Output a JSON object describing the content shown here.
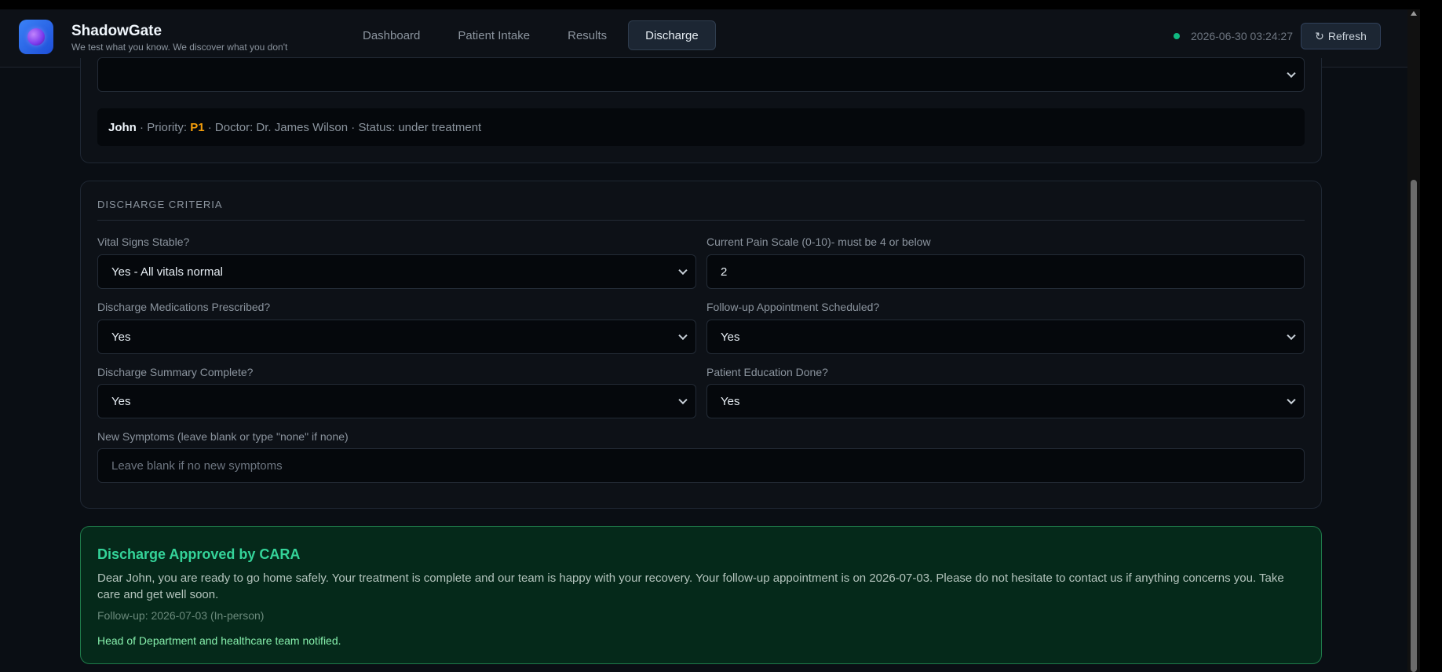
{
  "app": {
    "name": "ShadowGate",
    "tagline": "We test what you know. We discover what you don't"
  },
  "nav": {
    "tabs": [
      {
        "label": "Dashboard"
      },
      {
        "label": "Patient Intake"
      },
      {
        "label": "Results"
      },
      {
        "label": "Discharge"
      }
    ],
    "active": "Discharge"
  },
  "header": {
    "timestamp": "2026-06-30 03:24:27",
    "refresh_label": "Refresh",
    "refresh_icon": "↻",
    "status_color": "#10b981"
  },
  "patient": {
    "select_value": "",
    "name": "John",
    "priority_label": "Priority:",
    "priority": "P1",
    "doctor_text": "Doctor: Dr. James Wilson",
    "status_text": "Status: under treatment"
  },
  "criteria": {
    "title": "DISCHARGE CRITERIA",
    "vitals": {
      "label": "Vital Signs Stable?",
      "value": "Yes - All vitals normal"
    },
    "pain": {
      "label": "Current Pain Scale (0-10)- must be 4 or below",
      "value": "2"
    },
    "meds": {
      "label": "Discharge Medications Prescribed?",
      "value": "Yes"
    },
    "followup": {
      "label": "Follow-up Appointment Scheduled?",
      "value": "Yes"
    },
    "summary": {
      "label": "Discharge Summary Complete?",
      "value": "Yes"
    },
    "education": {
      "label": "Patient Education Done?",
      "value": "Yes"
    },
    "symptoms": {
      "label": "New Symptoms (leave blank or type \"none\" if none)",
      "value": "",
      "placeholder": "Leave blank if no new symptoms"
    }
  },
  "approval": {
    "title": "Discharge Approved by CARA",
    "message": "Dear John, you are ready to go home safely. Your treatment is complete and our team is happy with your recovery. Your follow-up appointment is on 2026-07-03. Please do not hesitate to contact us if anything concerns you. Take care and get well soon.",
    "followup": "Follow-up: 2026-07-03 (In-person)",
    "notified": "Head of Department and healthcare team notified.",
    "accent_color": "#34d399"
  }
}
